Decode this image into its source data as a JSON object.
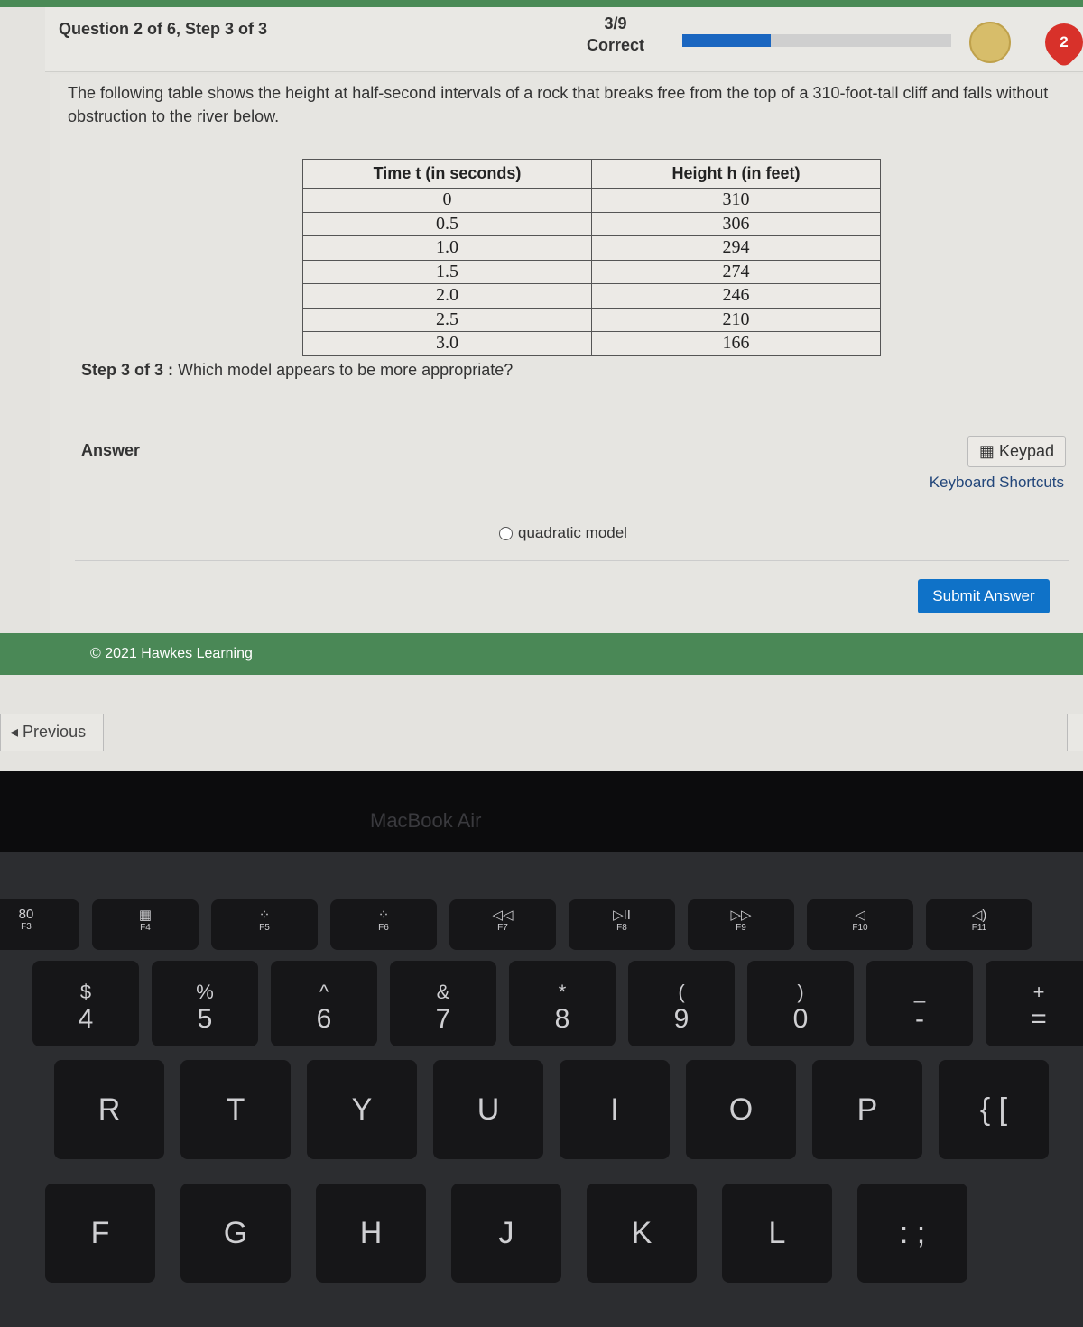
{
  "header": {
    "question": "Question 2 of 6, Step 3 of 3",
    "score": "3/9",
    "score_label": "Correct",
    "progress_percent": 33,
    "hearts": "2"
  },
  "prompt": "The following table shows the height at half-second intervals of a rock that breaks free from the top of a 310-foot-tall cliff and falls without obstruction to the river below.",
  "table": {
    "headers": [
      "Time t (in seconds)",
      "Height h (in feet)"
    ],
    "rows": [
      [
        "0",
        "310"
      ],
      [
        "0.5",
        "306"
      ],
      [
        "1.0",
        "294"
      ],
      [
        "1.5",
        "274"
      ],
      [
        "2.0",
        "246"
      ],
      [
        "2.5",
        "210"
      ],
      [
        "3.0",
        "166"
      ]
    ]
  },
  "step": {
    "label": "Step 3 of 3 :",
    "text": "Which model appears to be more appropriate?"
  },
  "answer": {
    "label": "Answer",
    "keypad": "Keypad",
    "shortcuts": "Keyboard Shortcuts",
    "option": "quadratic model",
    "submit": "Submit Answer"
  },
  "footer": "© 2021 Hawkes Learning",
  "nav": {
    "previous": "Previous"
  },
  "device": {
    "brand": "MacBook Air"
  },
  "keyboard": {
    "fkeys": [
      [
        "80",
        "F3"
      ],
      [
        "▦",
        "F4"
      ],
      [
        "⁘",
        "F5"
      ],
      [
        "⁘",
        "F6"
      ],
      [
        "◁◁",
        "F7"
      ],
      [
        "▷II",
        "F8"
      ],
      [
        "▷▷",
        "F9"
      ],
      [
        "◁",
        "F10"
      ],
      [
        "◁)",
        "F11"
      ]
    ],
    "numbers": [
      [
        "$",
        "4"
      ],
      [
        "%",
        "5"
      ],
      [
        "^",
        "6"
      ],
      [
        "&",
        "7"
      ],
      [
        "*",
        "8"
      ],
      [
        "(",
        "9"
      ],
      [
        ")",
        "0"
      ],
      [
        "_",
        "-"
      ],
      [
        "+",
        "="
      ]
    ],
    "row1": [
      "R",
      "T",
      "Y",
      "U",
      "I",
      "O",
      "P",
      "{ ["
    ],
    "row2": [
      "F",
      "G",
      "H",
      "J",
      "K",
      "L",
      ": ;"
    ]
  }
}
